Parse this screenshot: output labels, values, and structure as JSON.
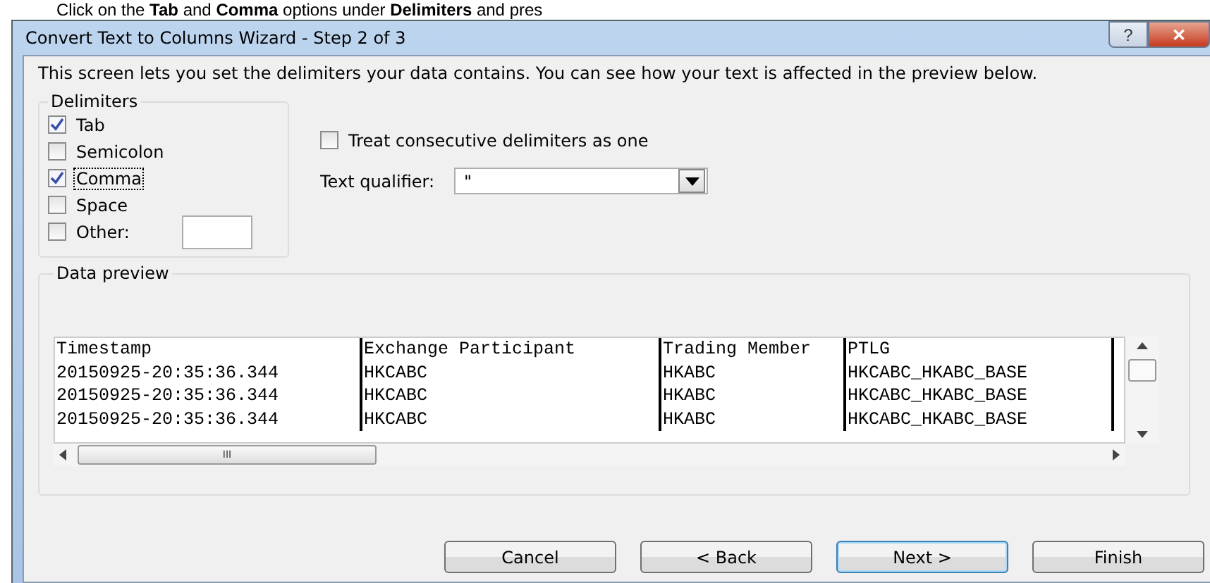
{
  "caption": "Click on the **Tab** and **Comma** options under **Delimiters** and pres",
  "window": {
    "title": "Convert Text to Columns Wizard - Step 2 of 3",
    "help_button": "?",
    "close_button": "✕"
  },
  "intro": "This screen lets you set the delimiters your data contains.  You can see how your text is affected in the preview below.",
  "delimiters": {
    "title": "Delimiters",
    "options": [
      {
        "label": "Tab",
        "checked": true,
        "focused": false
      },
      {
        "label": "Semicolon",
        "checked": false,
        "focused": false
      },
      {
        "label": "Comma",
        "checked": true,
        "focused": true
      },
      {
        "label": "Space",
        "checked": false,
        "focused": false
      },
      {
        "label": "Other:",
        "checked": false,
        "focused": false,
        "has_field": true
      }
    ]
  },
  "treat_consecutive": {
    "label": "Treat consecutive delimiters as one",
    "checked": false
  },
  "text_qualifier": {
    "label": "Text qualifier:",
    "value": "\""
  },
  "preview": {
    "title": "Data preview",
    "columns": [
      "Timestamp",
      "Exchange Participant",
      "Trading Member",
      "PTLG"
    ],
    "rows": [
      [
        "20150925-20:35:36.344",
        "HKCABC",
        "HKABC",
        "HKCABC_HKABC_BASE"
      ],
      [
        "20150925-20:35:36.344",
        "HKCABC",
        "HKABC",
        "HKCABC_HKABC_BASE"
      ],
      [
        "20150925-20:35:36.344",
        "HKCABC",
        "HKABC",
        "HKCABC_HKABC_BASE"
      ]
    ],
    "scroll_thumb": "III"
  },
  "buttons": [
    {
      "label": "Cancel",
      "default": false
    },
    {
      "label": "< Back",
      "default": false
    },
    {
      "label": "Next >",
      "default": true
    },
    {
      "label": "Finish",
      "default": false
    }
  ]
}
